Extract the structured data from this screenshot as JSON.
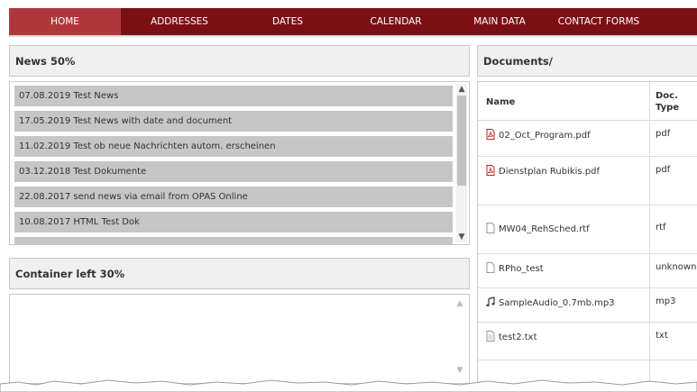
{
  "nav": {
    "items": [
      {
        "label": "HOME",
        "active": true
      },
      {
        "label": "ADDRESSES",
        "active": false
      },
      {
        "label": "DATES",
        "active": false
      },
      {
        "label": "CALENDAR",
        "active": false
      },
      {
        "label": "MAIN DATA",
        "active": false
      },
      {
        "label": "CONTACT FORMS",
        "active": false
      }
    ]
  },
  "news": {
    "title": "News 50%",
    "items": [
      "07.08.2019 Test News",
      "17.05.2019 Test News with date and document",
      "11.02.2019 Test ob neue Nachrichten autom. erscheinen",
      "03.12.2018 Test Dokumente",
      "22.08.2017 send news via email from OPAS Online",
      "10.08.2017 HTML Test Dok"
    ]
  },
  "left_container": {
    "title": "Container left 30%"
  },
  "documents": {
    "title": "Documents/",
    "columns": [
      "Name",
      "Doc. Type"
    ],
    "rows": [
      {
        "name": "02_Oct_Program.pdf",
        "type": "pdf",
        "icon": "pdf-icon"
      },
      {
        "name": "Dienstplan Rubikis.pdf",
        "type": "pdf",
        "icon": "pdf-icon"
      },
      {
        "name": "MW04_RehSched.rtf",
        "type": "rtf",
        "icon": "file-icon"
      },
      {
        "name": "RPho_test",
        "type": "unknown",
        "icon": "file-icon"
      },
      {
        "name": "SampleAudio_0.7mb.mp3",
        "type": "mp3",
        "icon": "audio-icon"
      },
      {
        "name": "test2.txt",
        "type": "txt",
        "icon": "text-file-icon"
      }
    ]
  },
  "colors": {
    "nav_bg": "#7b1014",
    "nav_active": "#b0383d",
    "news_item_bg": "#c6c6c6"
  }
}
